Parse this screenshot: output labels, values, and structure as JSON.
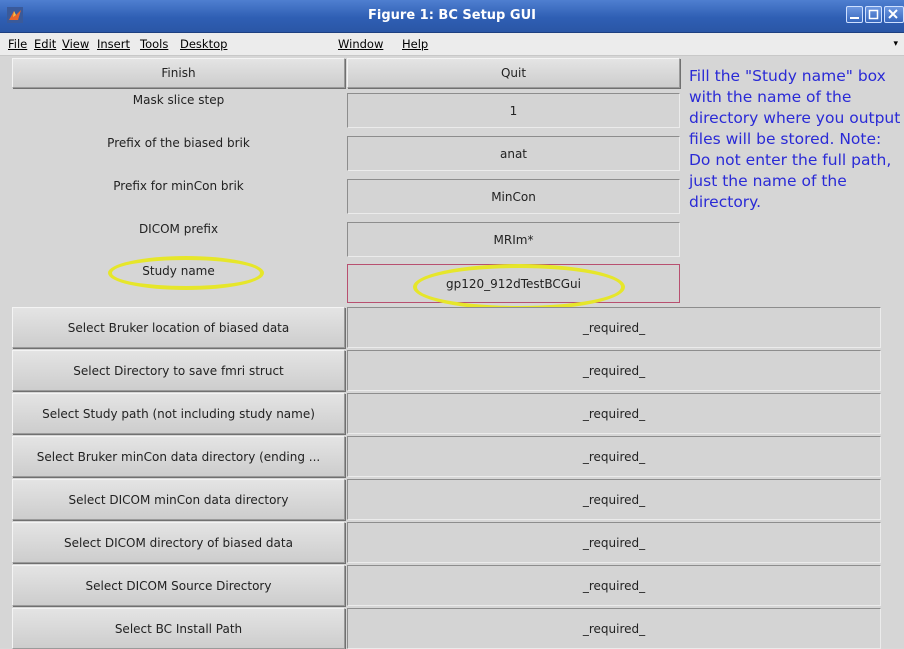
{
  "window": {
    "title": "Figure 1: BC Setup GUI",
    "title_color": "#2f5fb4"
  },
  "menu": [
    "File",
    "Edit",
    "View",
    "Insert",
    "Tools",
    "Desktop",
    "Window",
    "Help"
  ],
  "top_buttons": {
    "finish": "Finish",
    "quit": "Quit"
  },
  "params": [
    {
      "label": "Mask slice step",
      "value": "1"
    },
    {
      "label": "Prefix of the biased brik",
      "value": "anat"
    },
    {
      "label": "Prefix for minCon brik",
      "value": "MinCon"
    },
    {
      "label": "DICOM prefix",
      "value": "MRIm*"
    },
    {
      "label": "Study name",
      "value": "gp120_912dTestBCGui"
    }
  ],
  "help_text": "Fill the \"Study name\" box with the name of the directory where you output files will be stored. Note: Do not enter the full path, just the name of the directory.",
  "help_color": "#2a2ad6",
  "highlight_color": "#e6e62a",
  "selectors": [
    {
      "button": "Select Bruker location of biased data",
      "value": "_required_"
    },
    {
      "button": "Select Directory to save fmri struct",
      "value": "_required_"
    },
    {
      "button": "Select Study path (not including study name)",
      "value": "_required_"
    },
    {
      "button": "Select Bruker minCon data directory (ending ...",
      "value": "_required_"
    },
    {
      "button": "Select DICOM minCon data directory",
      "value": "_required_"
    },
    {
      "button": "Select DICOM directory of biased data",
      "value": "_required_"
    },
    {
      "button": "Select DICOM Source Directory",
      "value": "_required_"
    },
    {
      "button": "Select BC Install Path",
      "value": "_required_"
    }
  ]
}
